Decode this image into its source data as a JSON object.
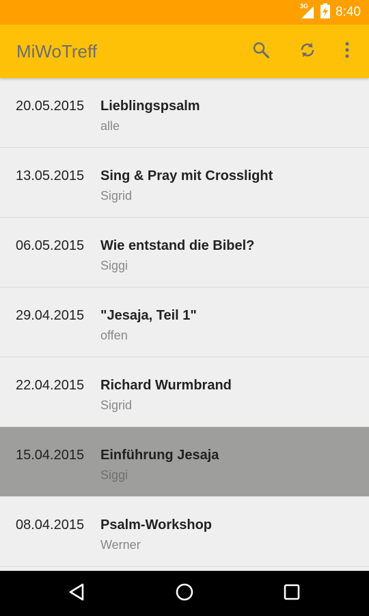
{
  "status_bar": {
    "time": "8:40",
    "network_label": "3G"
  },
  "app_bar": {
    "title": "MiWoTreff",
    "actions": [
      "search-icon",
      "refresh-icon",
      "more-vert-icon"
    ]
  },
  "events": [
    {
      "date": "20.05.2015",
      "title": "Lieblingspsalm",
      "subtitle": "alle"
    },
    {
      "date": "13.05.2015",
      "title": "Sing & Pray mit Crosslight",
      "subtitle": "Sigrid"
    },
    {
      "date": "06.05.2015",
      "title": "Wie entstand die Bibel?",
      "subtitle": "Siggi"
    },
    {
      "date": "29.04.2015",
      "title": "\"Jesaja, Teil 1\"",
      "subtitle": "offen"
    },
    {
      "date": "22.04.2015",
      "title": "Richard Wurmbrand",
      "subtitle": "Sigrid"
    },
    {
      "date": "15.04.2015",
      "title": "Einführung Jesaja",
      "subtitle": "Siggi"
    },
    {
      "date": "08.04.2015",
      "title": "Psalm-Workshop",
      "subtitle": "Werner"
    }
  ],
  "selected_index": 5,
  "colors": {
    "accent": "#FFC107",
    "status_bar": "#FFA000",
    "selected_row": "#9E9E9C"
  }
}
